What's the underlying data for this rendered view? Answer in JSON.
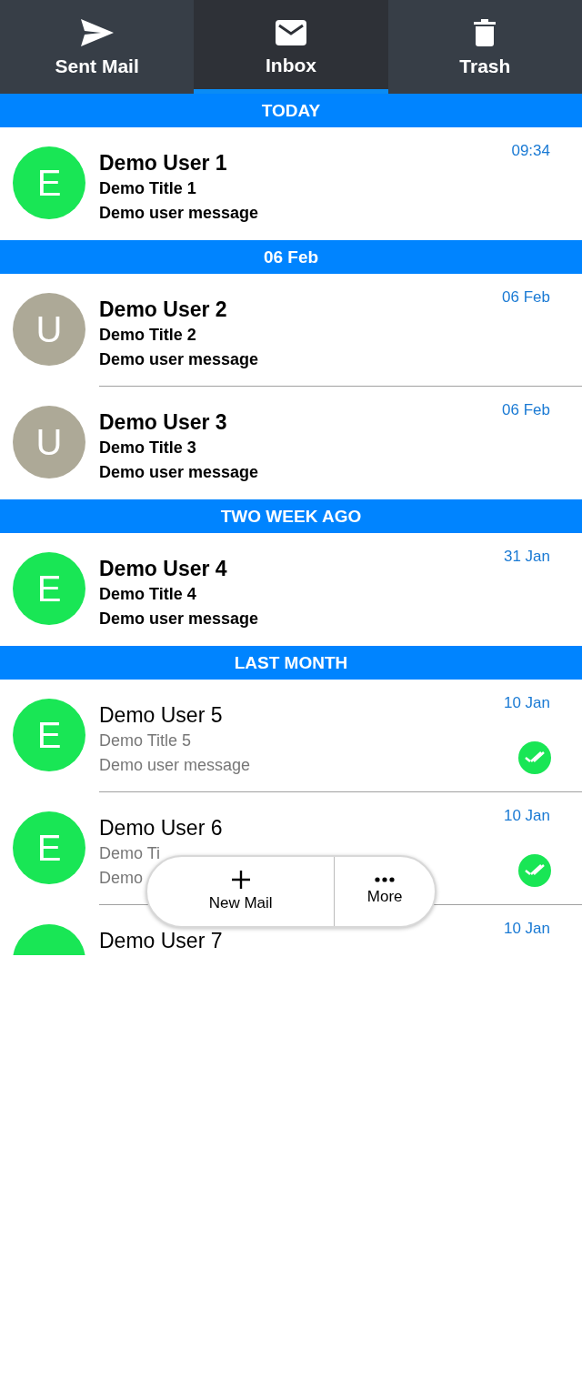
{
  "tabs": [
    {
      "label": "Sent Mail",
      "selected": false
    },
    {
      "label": "Inbox",
      "selected": true
    },
    {
      "label": "Trash",
      "selected": false
    }
  ],
  "sections": [
    {
      "title": "TODAY",
      "mails": [
        {
          "avatar": "E",
          "color": "#19e655",
          "sender": "Demo User 1",
          "subject": "Demo Title 1",
          "preview": "Demo user message",
          "date": "09:34",
          "unread": true,
          "seen_mark": false
        }
      ]
    },
    {
      "title": "06 Feb",
      "mails": [
        {
          "avatar": "U",
          "color": "#ada997",
          "sender": "Demo User 2",
          "subject": "Demo Title 2",
          "preview": "Demo user message",
          "date": "06 Feb",
          "unread": true,
          "seen_mark": false
        },
        {
          "avatar": "U",
          "color": "#ada997",
          "sender": "Demo User 3",
          "subject": "Demo Title 3",
          "preview": "Demo user message",
          "date": "06 Feb",
          "unread": true,
          "seen_mark": false
        }
      ]
    },
    {
      "title": "TWO WEEK AGO",
      "mails": [
        {
          "avatar": "E",
          "color": "#19e655",
          "sender": "Demo User 4",
          "subject": "Demo Title 4",
          "preview": "Demo user message",
          "date": "31 Jan",
          "unread": true,
          "seen_mark": false
        }
      ]
    },
    {
      "title": "LAST MONTH",
      "mails": [
        {
          "avatar": "E",
          "color": "#19e655",
          "sender": "Demo User 5",
          "subject": "Demo Title 5",
          "preview": "Demo user message",
          "date": "10 Jan",
          "unread": false,
          "seen_mark": true
        },
        {
          "avatar": "E",
          "color": "#19e655",
          "sender": "Demo User 6",
          "subject": "Demo Ti",
          "preview": "Demo",
          "date": "10 Jan",
          "unread": false,
          "seen_mark": true
        },
        {
          "color": "#19e655",
          "sender": "Demo User 7",
          "date": "10 Jan",
          "unread": false,
          "seen_mark": false
        }
      ]
    }
  ],
  "actions": [
    {
      "label": "New Mail"
    },
    {
      "label": "More"
    }
  ]
}
